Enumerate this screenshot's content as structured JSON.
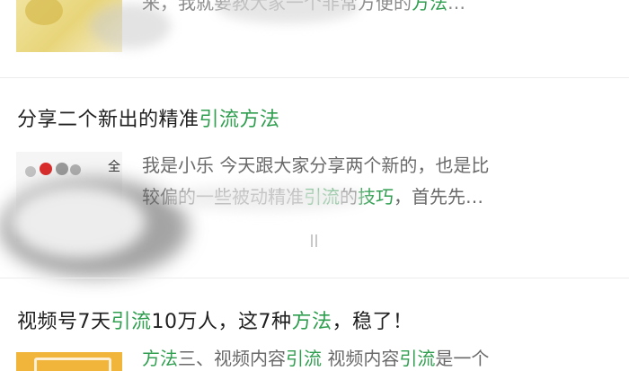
{
  "article1": {
    "snippet_parts": [
      "来，我就要教大家",
      "一个非常方便的",
      "方法",
      "…"
    ]
  },
  "article2": {
    "title_plain": "分享二个新出的精准",
    "title_hl": "引流方法",
    "thumb_label": "全",
    "snippet_line1": "我是小乐 今天跟大家分享两个新的，也是比",
    "snippet_line2_a": "较偏的一些被动精准",
    "snippet_line2_hl1": "引流",
    "snippet_line2_b": "的",
    "snippet_line2_hl2": "技巧",
    "snippet_line2_c": "，首先先…"
  },
  "article3": {
    "title_a": "视频号7天",
    "title_hl1": "引流",
    "title_b": "10万人，这7种",
    "title_hl2": "方法",
    "title_c": "，稳了！",
    "snippet_hl1": "方法",
    "snippet_a": "三、视频内容",
    "snippet_hl2": "引流",
    "snippet_b": " 视频内容",
    "snippet_hl3": "引流",
    "snippet_c": "是一个"
  },
  "colors": {
    "highlight": "#2f9e4f",
    "title": "#1f1f1f",
    "snippet": "#6a6a6a"
  }
}
